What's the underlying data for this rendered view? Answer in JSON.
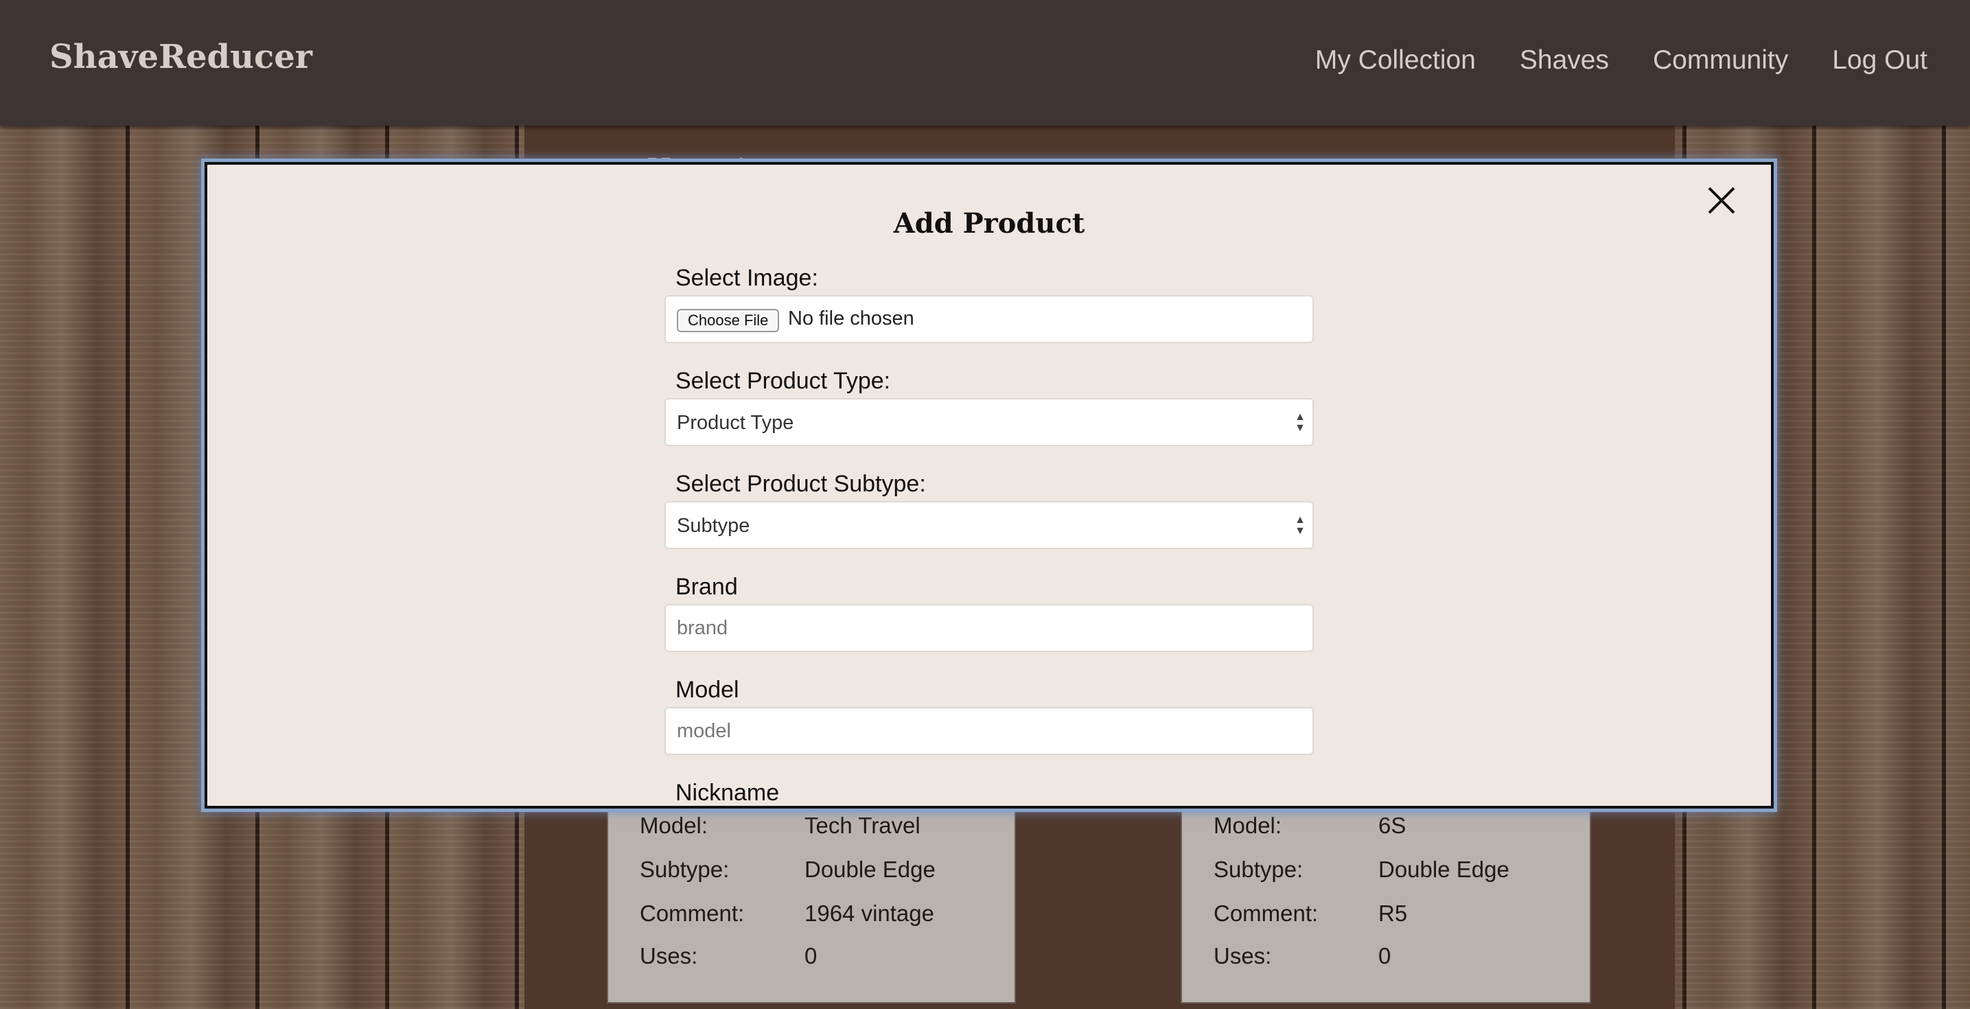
{
  "nav": {
    "brand": "ShaveReducer",
    "links": [
      "My Collection",
      "Shaves",
      "Community",
      "Log Out"
    ]
  },
  "page": {
    "title": "My Collection"
  },
  "cards": [
    {
      "rows": [
        {
          "key": "Model:",
          "value": "Tech Travel"
        },
        {
          "key": "Subtype:",
          "value": "Double Edge"
        },
        {
          "key": "Comment:",
          "value": "1964 vintage"
        },
        {
          "key": "Uses:",
          "value": "0"
        }
      ]
    },
    {
      "rows": [
        {
          "key": "Model:",
          "value": "6S"
        },
        {
          "key": "Subtype:",
          "value": "Double Edge"
        },
        {
          "key": "Comment:",
          "value": "R5"
        },
        {
          "key": "Uses:",
          "value": "0"
        }
      ]
    }
  ],
  "modal": {
    "title": "Add Product",
    "image": {
      "label": "Select Image:",
      "button": "Choose File",
      "status": "No file chosen"
    },
    "product_type": {
      "label": "Select Product Type:",
      "selected": "Product Type"
    },
    "subtype": {
      "label": "Select Product Subtype:",
      "selected": "Subtype"
    },
    "brand": {
      "label": "Brand",
      "placeholder": "brand"
    },
    "model": {
      "label": "Model",
      "placeholder": "model"
    },
    "nickname": {
      "label": "Nickname"
    }
  },
  "colors": {
    "nav_bg": "#3e3431",
    "modal_bg": "#efe7e2",
    "modal_glow": "#8ba3c9",
    "card_bg": "#b9b2ae"
  }
}
